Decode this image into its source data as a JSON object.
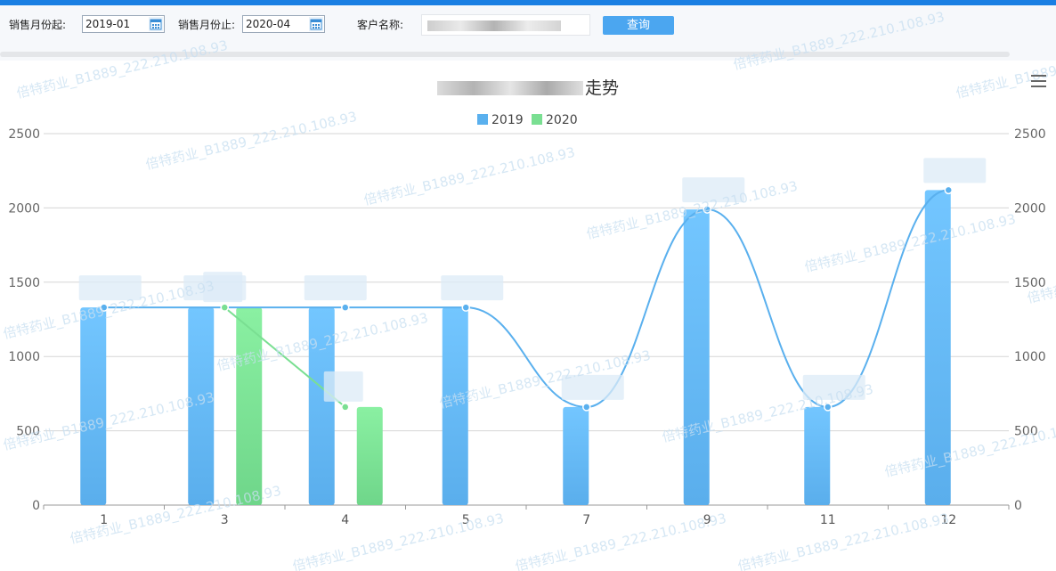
{
  "filters": {
    "start_label": "销售月份起:",
    "start_value": "2019-01",
    "end_label": "销售月份止:",
    "end_value": "2020-04",
    "customer_label": "客户名称:",
    "query_button": "查询"
  },
  "icons": [
    "calendar-icon",
    "hamburger-menu-icon"
  ],
  "colors": {
    "topbar": "#1a7fe3",
    "button": "#4ba6f0",
    "series_2019": "#5ab0ee",
    "series_2020": "#7adf92"
  },
  "chart_data": {
    "type": "bar",
    "title_suffix": "走势",
    "categories": [
      "1",
      "3",
      "4",
      "5",
      "7",
      "9",
      "11",
      "12"
    ],
    "series": [
      {
        "name": "2019",
        "type": "bar",
        "values": [
          1330,
          1330,
          1330,
          1330,
          660,
          1990,
          660,
          2120
        ]
      },
      {
        "name": "2020",
        "type": "bar",
        "values": [
          null,
          1330,
          660,
          null,
          null,
          null,
          null,
          null
        ]
      },
      {
        "name": "2019",
        "type": "line",
        "values": [
          1330,
          1330,
          1330,
          1330,
          660,
          1990,
          660,
          2120
        ]
      },
      {
        "name": "2020",
        "type": "line",
        "values": [
          null,
          1330,
          660,
          null,
          null,
          null,
          null,
          null
        ]
      }
    ],
    "ylim": [
      0,
      2500
    ],
    "y_ticks": [
      "0",
      "500",
      "1000",
      "1500",
      "2000",
      "2500"
    ],
    "legend": "top-center",
    "grid": true
  },
  "watermark": "倍特药业_B1889_222.210.108.93"
}
